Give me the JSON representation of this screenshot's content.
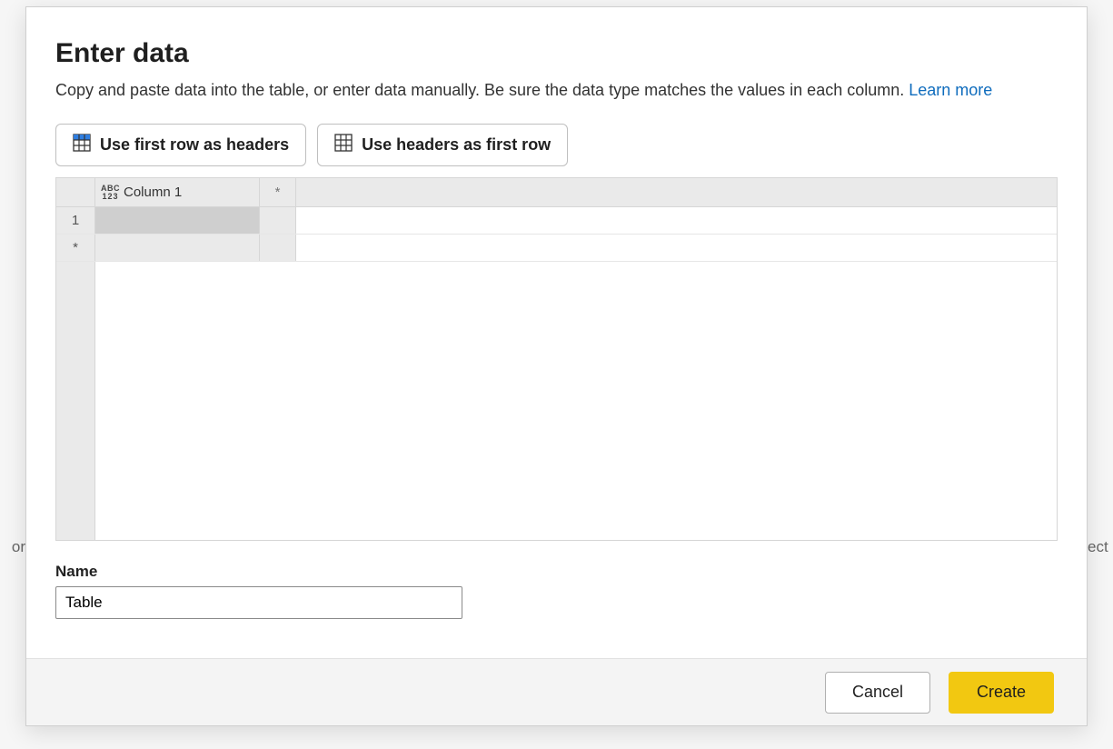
{
  "header": {
    "title": "Enter data",
    "subtitle_text": "Copy and paste data into the table, or enter data manually. Be sure the data type matches the values in each column. ",
    "subtitle_link": "Learn more"
  },
  "toolbar": {
    "first_row_headers": "Use first row as headers",
    "headers_first_row": "Use headers as first row"
  },
  "grid": {
    "type_badge_l1": "ABC",
    "type_badge_l2": "123",
    "column1_header": "Column 1",
    "add_col_symbol": "*",
    "row1_number": "1",
    "row1_col1_value": "",
    "add_row_symbol": "*"
  },
  "name_field": {
    "label": "Name",
    "value": "Table"
  },
  "footer": {
    "cancel": "Cancel",
    "create": "Create"
  },
  "background": {
    "left_fragment": "or",
    "right_fragment": "ect"
  }
}
